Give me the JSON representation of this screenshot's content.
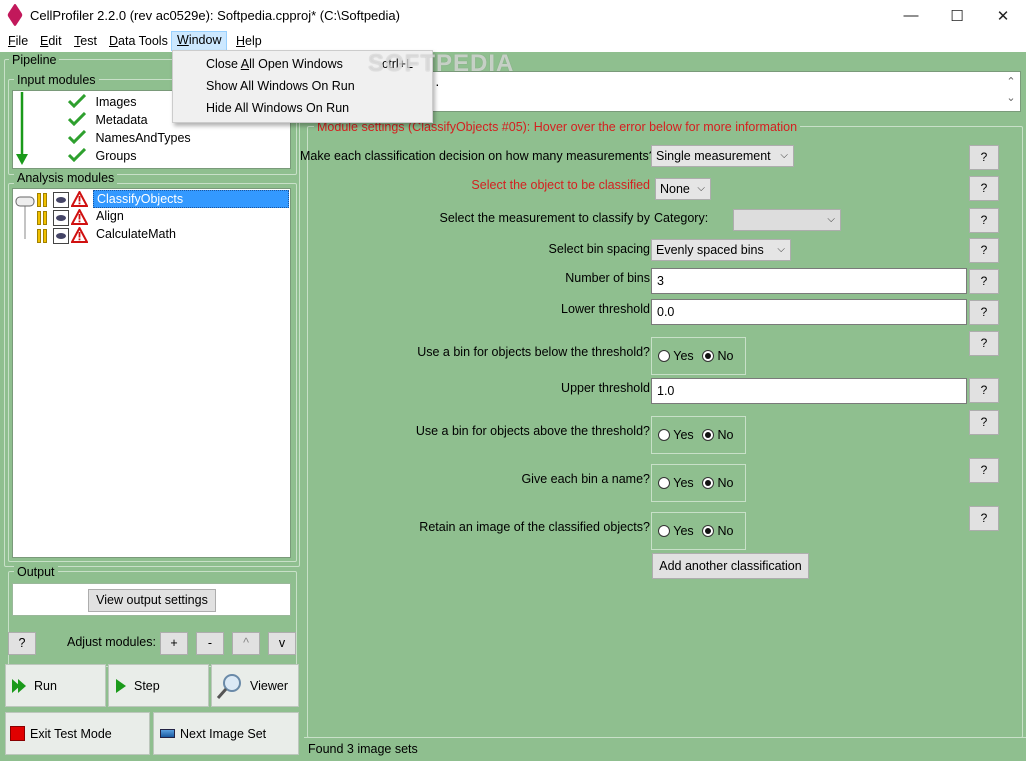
{
  "titlebar": {
    "title": "CellProfiler 2.2.0 (rev ac0529e): Softpedia.cpproj* (C:\\Softpedia)",
    "minimize": "—",
    "maximize": "☐",
    "close": "✕"
  },
  "menubar": {
    "items": [
      {
        "pre": "",
        "ul": "F",
        "post": "ile"
      },
      {
        "pre": "",
        "ul": "E",
        "post": "dit"
      },
      {
        "pre": "",
        "ul": "T",
        "post": "est"
      },
      {
        "pre": "",
        "ul": "D",
        "post": "ata Tools"
      },
      {
        "pre": "",
        "ul": "W",
        "post": "indow"
      },
      {
        "pre": "",
        "ul": "H",
        "post": "elp"
      }
    ]
  },
  "window_menu": {
    "items": [
      {
        "pre": "Close ",
        "ul": "A",
        "post": "ll Open Windows",
        "shortcut": "ctrl+L"
      },
      {
        "pre": "Show All Windows On Run",
        "ul": "",
        "post": "",
        "shortcut": ""
      },
      {
        "pre": "Hide All Windows On Run",
        "ul": "",
        "post": "",
        "shortcut": ""
      }
    ]
  },
  "watermark": "SOFTPEDIA",
  "left": {
    "pipeline_label": "Pipeline",
    "input_modules_label": "Input modules",
    "input_modules": [
      "Images",
      "Metadata",
      "NamesAndTypes",
      "Groups"
    ],
    "analysis_modules_label": "Analysis modules",
    "analysis_modules": [
      "ClassifyObjects",
      "Align",
      "CalculateMath"
    ],
    "output_label": "Output",
    "view_output_settings": "View output settings",
    "help_button": "?",
    "adjust_modules_label": "Adjust modules:",
    "adjust_buttons": [
      "+",
      "-",
      "^",
      "v"
    ],
    "run": "Run",
    "step": "Step",
    "viewer": "Viewer",
    "exit_test_mode": "Exit Test Mode",
    "next_image_set": "Next Image Set"
  },
  "right": {
    "notes_scroll_up": "⌃",
    "notes_scroll_down": "⌄",
    "module_settings_label": "Module settings (ClassifyObjects #05): Hover over the error below for more information",
    "q": "?",
    "settings": {
      "decision_label": "Make each classification decision on how many measurements?",
      "decision_value": "Single measurement",
      "object_label": "Select the object to be classified",
      "object_value": "None",
      "measurement_label": "Select the measurement to classify by",
      "category_label": "Category:",
      "category_value": "",
      "bin_spacing_label": "Select bin spacing",
      "bin_spacing_value": "Evenly spaced bins",
      "num_bins_label": "Number of bins",
      "num_bins_value": "3",
      "lower_threshold_label": "Lower threshold",
      "lower_threshold_value": "0.0",
      "below_bin_label": "Use a bin for objects below the threshold?",
      "upper_threshold_label": "Upper threshold",
      "upper_threshold_value": "1.0",
      "above_bin_label": "Use a bin for objects above the threshold?",
      "bin_name_label": "Give each bin a name?",
      "retain_image_label": "Retain an image of the classified objects?",
      "yes": "Yes",
      "no": "No",
      "add_classification": "Add another classification"
    },
    "status": "Found 3 image sets"
  },
  "colors": {
    "panel_green": "#8fbf8f",
    "error_red": "#d42020",
    "selection_blue": "#3399ff"
  }
}
